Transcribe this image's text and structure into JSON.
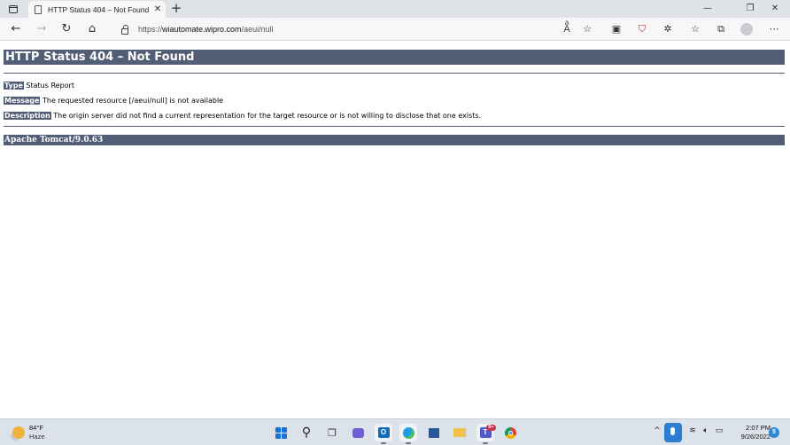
{
  "browser": {
    "tab": {
      "title": "HTTP Status 404 – Not Found"
    },
    "address": {
      "scheme": "https://",
      "host": "wiautomate.wipro.com",
      "path": "/aeui/null"
    }
  },
  "page": {
    "heading": "HTTP Status 404 – Not Found",
    "type_label": "Type",
    "type_value": "Status Report",
    "message_label": "Message",
    "message_value": "The requested resource [/aeui/null] is not available",
    "description_label": "Description",
    "description_value": "The origin server did not find a current representation for the target resource or is not willing to disclose that one exists.",
    "server": "Apache Tomcat/9.0.63"
  },
  "taskbar": {
    "weather": {
      "temp": "84°F",
      "condition": "Haze"
    },
    "teams_badge": "9+",
    "clock": {
      "time": "2:07 PM",
      "date": "9/26/2022"
    },
    "notification_count": "5"
  },
  "colors": {
    "tomcat_header": "#525d76",
    "accent": "#2d7dd2"
  }
}
